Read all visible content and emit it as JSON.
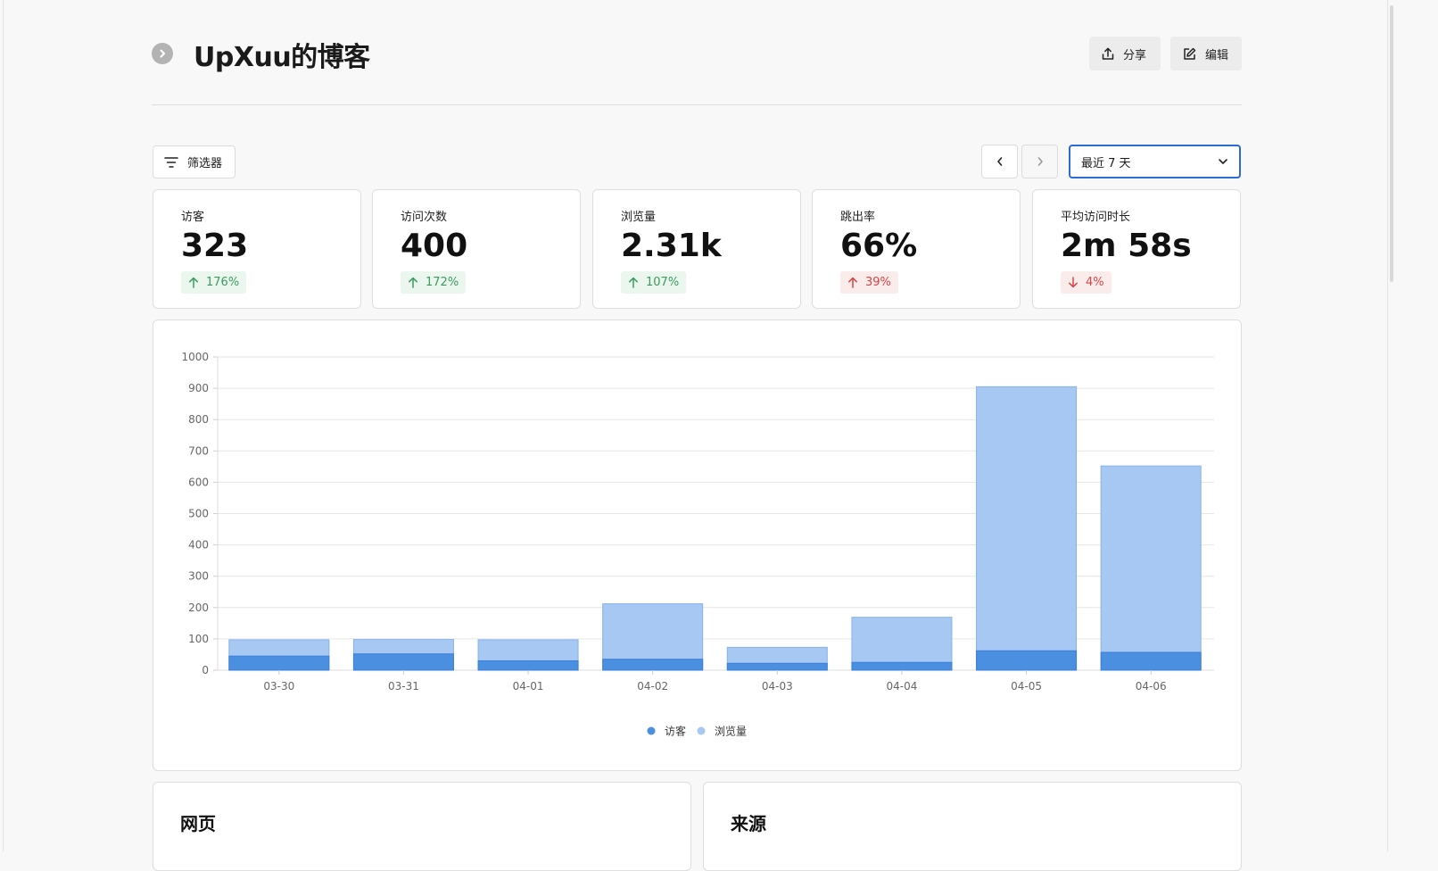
{
  "header": {
    "title": "UpXuu的博客",
    "share_label": "分享",
    "edit_label": "编辑"
  },
  "toolbar": {
    "filter_label": "筛选器",
    "date_range": "最近 7 天"
  },
  "metrics": [
    {
      "label": "访客",
      "value": "323",
      "change": "176%",
      "direction": "up"
    },
    {
      "label": "访问次数",
      "value": "400",
      "change": "172%",
      "direction": "up"
    },
    {
      "label": "浏览量",
      "value": "2.31k",
      "change": "107%",
      "direction": "up"
    },
    {
      "label": "跳出率",
      "value": "66%",
      "change": "39%",
      "direction": "up",
      "negative": true
    },
    {
      "label": "平均访问时长",
      "value": "2m 58s",
      "change": "4%",
      "direction": "down",
      "negative": true
    }
  ],
  "chart_data": {
    "type": "bar",
    "categories": [
      "03-30",
      "03-31",
      "04-01",
      "04-02",
      "04-03",
      "04-04",
      "04-05",
      "04-06"
    ],
    "series": [
      {
        "name": "访客",
        "values": [
          45,
          52,
          30,
          35,
          22,
          25,
          62,
          57
        ],
        "color": "#4a8fe0"
      },
      {
        "name": "浏览量",
        "values": [
          97,
          98,
          97,
          212,
          73,
          169,
          905,
          652
        ],
        "color": "#a6c8f3"
      }
    ],
    "ylim": [
      0,
      1000
    ],
    "yticks": [
      0,
      100,
      200,
      300,
      400,
      500,
      600,
      700,
      800,
      900,
      1000
    ],
    "grid": true,
    "legend": "bottom-center",
    "overlay": true
  },
  "panels": {
    "pages_title": "网页",
    "referrers_title": "来源"
  }
}
